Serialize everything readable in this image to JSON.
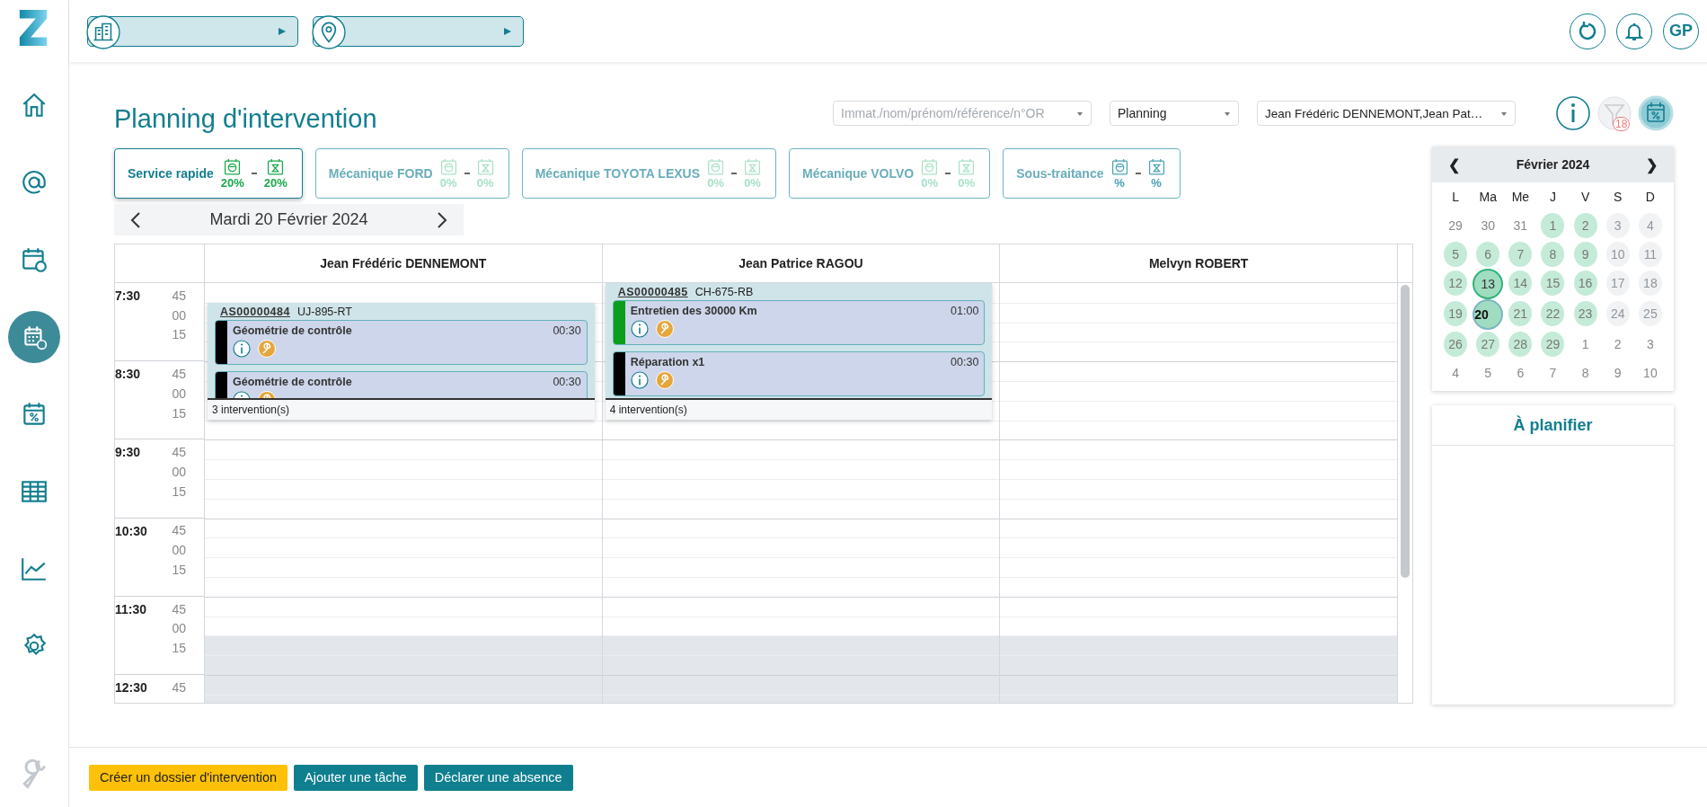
{
  "sidebar": {
    "items": [
      {
        "selected": false
      },
      {
        "selected": false
      },
      {
        "selected": false
      },
      {
        "selected": true
      },
      {
        "selected": false
      },
      {
        "selected": false
      },
      {
        "selected": false
      },
      {
        "selected": false
      }
    ]
  },
  "user": {
    "initials": "GP"
  },
  "title": "Planning d'intervention",
  "filters": {
    "search": {
      "placeholder": "Immat./nom/prénom/référence/n°OR"
    },
    "view": {
      "value": "Planning"
    },
    "resources": {
      "value": "Jean Frédéric DENNEMONT,Jean Pat…"
    }
  },
  "toolbar": {
    "filter_badge": "18",
    "filter_disabled": true,
    "occupancy_selected": true
  },
  "services": [
    {
      "label": "Service rapide",
      "selected": true,
      "color": "#18a84a",
      "first": "20%",
      "second": "20%"
    },
    {
      "label": "Mécanique FORD",
      "selected": false,
      "color": "#a9e2c8",
      "first": "0%",
      "second": "0%"
    },
    {
      "label": "Mécanique TOYOTA LEXUS",
      "selected": false,
      "color": "#a9e2c8",
      "first": "0%",
      "second": "0%"
    },
    {
      "label": "Mécanique VOLVO",
      "selected": false,
      "color": "#a9e2c8",
      "first": "0%",
      "second": "0%"
    },
    {
      "label": "Sous-traitance",
      "selected": false,
      "color": "#4aa3b3",
      "first": "%",
      "second": "%"
    }
  ],
  "date": {
    "label": "Mardi 20 Février 2024"
  },
  "time_blocks": [
    {
      "hour": "7:30",
      "slots": [
        {
          "minute": "45",
          "closed": false
        },
        {
          "minute": "00",
          "closed": false
        },
        {
          "minute": "15",
          "closed": false
        },
        {
          "closed": false
        }
      ]
    },
    {
      "hour": "8:30",
      "slots": [
        {
          "minute": "45",
          "closed": false
        },
        {
          "minute": "00",
          "closed": false
        },
        {
          "minute": "15",
          "closed": false
        },
        {
          "closed": false
        }
      ]
    },
    {
      "hour": "9:30",
      "slots": [
        {
          "minute": "45",
          "closed": false
        },
        {
          "minute": "00",
          "closed": false
        },
        {
          "minute": "15",
          "closed": false
        },
        {
          "closed": false
        }
      ]
    },
    {
      "hour": "10:30",
      "slots": [
        {
          "minute": "45",
          "closed": false
        },
        {
          "minute": "00",
          "closed": false
        },
        {
          "minute": "15",
          "closed": false
        },
        {
          "closed": false
        }
      ]
    },
    {
      "hour": "11:30",
      "slots": [
        {
          "minute": "45",
          "closed": false
        },
        {
          "minute": "00",
          "closed": false
        },
        {
          "minute": "15",
          "closed": true
        },
        {
          "closed": true
        }
      ]
    },
    {
      "hour": "12:30",
      "slots": [
        {
          "minute": "45",
          "closed": true
        },
        {
          "closed": true
        }
      ]
    }
  ],
  "resources": [
    {
      "name": "Jean Frédéric DENNEMONT",
      "folder": {
        "reference": "AS00000484",
        "plate": "UJ-895-RT",
        "count": "3 intervention(s)",
        "tasks": [
          {
            "title": "Géométrie de contrôle",
            "duration": "00:30",
            "color": "#000000"
          },
          {
            "title": "Géométrie de contrôle",
            "duration": "00:30",
            "color": "#000000"
          }
        ]
      }
    },
    {
      "name": "Jean Patrice RAGOU",
      "folder": {
        "reference": "AS00000485",
        "plate": "CH-675-RB",
        "count": "4 intervention(s)",
        "tasks": [
          {
            "title": "Entretien des 30000 Km",
            "duration": "01:00",
            "color": "#0a9e1a"
          },
          {
            "title": "Réparation x1",
            "duration": "00:30",
            "color": "#000000"
          }
        ]
      }
    },
    {
      "name": "Melvyn ROBERT"
    }
  ],
  "calendar": {
    "month": "Février 2024",
    "prev": "❮",
    "next": "❯",
    "weekdays": [
      "L",
      "Ma",
      "Me",
      "J",
      "V",
      "S",
      "D"
    ],
    "days": [
      {
        "day": "29",
        "kind": "outside",
        "selected": false,
        "marked": false
      },
      {
        "day": "30",
        "kind": "outside",
        "selected": false,
        "marked": false
      },
      {
        "day": "31",
        "kind": "outside",
        "selected": false,
        "marked": false
      },
      {
        "day": "1",
        "kind": "open",
        "selected": false,
        "marked": false
      },
      {
        "day": "2",
        "kind": "open",
        "selected": false,
        "marked": false
      },
      {
        "day": "3",
        "kind": "closed",
        "selected": false,
        "marked": false
      },
      {
        "day": "4",
        "kind": "closed",
        "selected": false,
        "marked": false
      },
      {
        "day": "5",
        "kind": "open",
        "selected": false,
        "marked": false
      },
      {
        "day": "6",
        "kind": "open",
        "selected": false,
        "marked": false
      },
      {
        "day": "7",
        "kind": "open",
        "selected": false,
        "marked": false
      },
      {
        "day": "8",
        "kind": "open",
        "selected": false,
        "marked": false
      },
      {
        "day": "9",
        "kind": "open",
        "selected": false,
        "marked": false
      },
      {
        "day": "10",
        "kind": "closed",
        "selected": false,
        "marked": false
      },
      {
        "day": "11",
        "kind": "closed",
        "selected": false,
        "marked": false
      },
      {
        "day": "12",
        "kind": "open",
        "selected": false,
        "marked": false
      },
      {
        "day": "13",
        "kind": "open",
        "selected": false,
        "marked": true
      },
      {
        "day": "14",
        "kind": "open",
        "selected": false,
        "marked": false
      },
      {
        "day": "15",
        "kind": "open",
        "selected": false,
        "marked": false
      },
      {
        "day": "16",
        "kind": "open",
        "selected": false,
        "marked": false
      },
      {
        "day": "17",
        "kind": "closed",
        "selected": false,
        "marked": false
      },
      {
        "day": "18",
        "kind": "closed",
        "selected": false,
        "marked": false
      },
      {
        "day": "19",
        "kind": "open",
        "selected": false,
        "marked": false
      },
      {
        "day": "20",
        "kind": "open",
        "selected": true,
        "marked": false
      },
      {
        "day": "21",
        "kind": "open",
        "selected": false,
        "marked": false
      },
      {
        "day": "22",
        "kind": "open",
        "selected": false,
        "marked": false
      },
      {
        "day": "23",
        "kind": "open",
        "selected": false,
        "marked": false
      },
      {
        "day": "24",
        "kind": "closed",
        "selected": false,
        "marked": false
      },
      {
        "day": "25",
        "kind": "closed",
        "selected": false,
        "marked": false
      },
      {
        "day": "26",
        "kind": "open",
        "selected": false,
        "marked": false
      },
      {
        "day": "27",
        "kind": "open",
        "selected": false,
        "marked": false
      },
      {
        "day": "28",
        "kind": "open",
        "selected": false,
        "marked": false
      },
      {
        "day": "29",
        "kind": "open",
        "selected": false,
        "marked": false
      },
      {
        "day": "1",
        "kind": "outside",
        "selected": false,
        "marked": false
      },
      {
        "day": "2",
        "kind": "outside",
        "selected": false,
        "marked": false
      },
      {
        "day": "3",
        "kind": "outside",
        "selected": false,
        "marked": false
      },
      {
        "day": "4",
        "kind": "outside",
        "selected": false,
        "marked": false
      },
      {
        "day": "5",
        "kind": "outside",
        "selected": false,
        "marked": false
      },
      {
        "day": "6",
        "kind": "outside",
        "selected": false,
        "marked": false
      },
      {
        "day": "7",
        "kind": "outside",
        "selected": false,
        "marked": false
      },
      {
        "day": "8",
        "kind": "outside",
        "selected": false,
        "marked": false
      },
      {
        "day": "9",
        "kind": "outside",
        "selected": false,
        "marked": false
      },
      {
        "day": "10",
        "kind": "outside",
        "selected": false,
        "marked": false
      }
    ]
  },
  "backlog": {
    "title": "À planifier"
  },
  "actions": [
    {
      "label": "Créer un dossier d'intervention",
      "kind": "primary"
    },
    {
      "label": "Ajouter une tâche",
      "kind": "secondary"
    },
    {
      "label": "Déclarer une absence",
      "kind": "secondary"
    }
  ]
}
